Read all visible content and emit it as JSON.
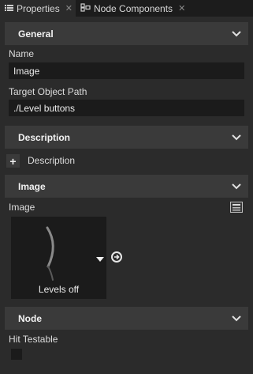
{
  "tabs": [
    {
      "label": "Properties",
      "icon": "list-icon",
      "active": true
    },
    {
      "label": "Node Components",
      "icon": "components-icon",
      "active": false
    }
  ],
  "sections": {
    "general": {
      "title": "General",
      "name_label": "Name",
      "name_value": "Image",
      "target_label": "Target Object Path",
      "target_value": "./Level buttons"
    },
    "description": {
      "title": "Description",
      "add_label": "+",
      "item_label": "Description"
    },
    "image": {
      "title": "Image",
      "property_label": "Image",
      "preview_caption": "Levels off"
    },
    "node": {
      "title": "Node",
      "hit_testable_label": "Hit Testable",
      "hit_testable_checked": false
    }
  },
  "colors": {
    "background": "#2b2b2b",
    "header": "#3a3a3a",
    "field": "#1b1b1b",
    "tabbar": "#1c1c1c"
  }
}
